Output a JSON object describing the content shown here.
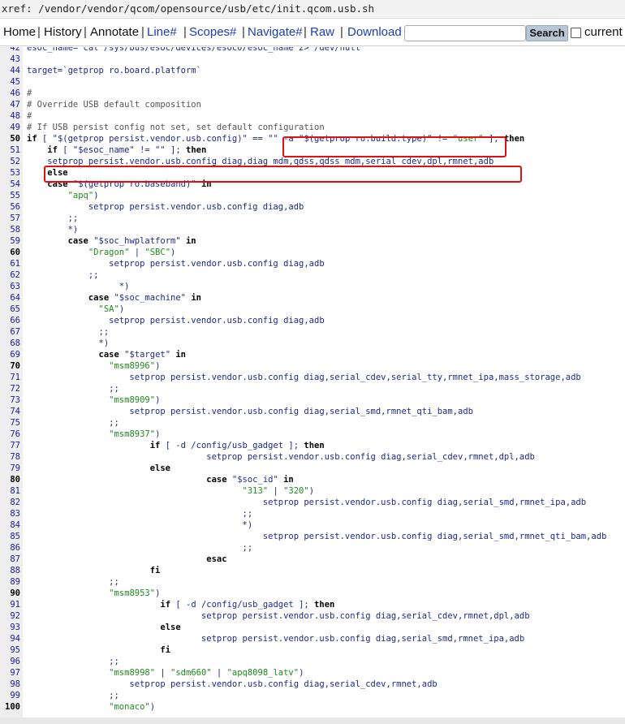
{
  "xref": {
    "prefix": "xref:",
    "path": " /vendor/vendor/qcom/opensource/usb/etc/init.qcom.usb.sh"
  },
  "nav": {
    "home": "Home",
    "history": "History",
    "annotate": "Annotate",
    "line": "Line#",
    "scopes": "Scopes#",
    "navigate": "Navigate#",
    "raw": "Raw",
    "download": "Download",
    "search_button": "Search",
    "current": "current",
    "search_value": ""
  },
  "highlight_color": "#e01010",
  "lines": [
    {
      "n": "42",
      "b": false,
      "parts": [
        {
          "t": "esoc_name=`cat /sys/bus/esoc/devices/esoc0/esoc_name 2> /dev/null`"
        }
      ]
    },
    {
      "n": "43",
      "b": false,
      "parts": [
        {
          "t": ""
        }
      ]
    },
    {
      "n": "44",
      "b": false,
      "parts": [
        {
          "t": "target=`getprop ro.board.platform`"
        }
      ]
    },
    {
      "n": "45",
      "b": false,
      "parts": [
        {
          "t": ""
        }
      ]
    },
    {
      "n": "46",
      "b": false,
      "parts": [
        {
          "t": "#",
          "c": "cm"
        }
      ]
    },
    {
      "n": "47",
      "b": false,
      "parts": [
        {
          "t": "# Override USB default composition",
          "c": "cm"
        }
      ]
    },
    {
      "n": "48",
      "b": false,
      "parts": [
        {
          "t": "#",
          "c": "cm"
        }
      ]
    },
    {
      "n": "49",
      "b": false,
      "parts": [
        {
          "t": "# If USB persist config not set, set default configuration",
          "c": "cm"
        }
      ]
    },
    {
      "n": "50",
      "b": true,
      "parts": [
        {
          "t": "if",
          "c": "kw"
        },
        {
          "t": " [ \"$(getprop persist.vendor.usb.config)\" == \"\" -a \"$(getprop ro.build.type)\" != "
        },
        {
          "t": "\"user\"",
          "c": "str"
        },
        {
          "t": " ]; "
        },
        {
          "t": "then",
          "c": "kw"
        }
      ]
    },
    {
      "n": "51",
      "b": false,
      "parts": [
        {
          "t": "    "
        },
        {
          "t": "if",
          "c": "kw"
        },
        {
          "t": " [ \"$esoc_name\" != \"\" ]; "
        },
        {
          "t": "then",
          "c": "kw"
        }
      ]
    },
    {
      "n": "52",
      "b": false,
      "parts": [
        {
          "t": "    setprop persist.vendor.usb.config diag,diag_mdm,qdss,qdss_mdm,serial_cdev,dpl,rmnet,adb"
        }
      ]
    },
    {
      "n": "53",
      "b": false,
      "parts": [
        {
          "t": "    "
        },
        {
          "t": "else",
          "c": "kw"
        }
      ]
    },
    {
      "n": "54",
      "b": false,
      "parts": [
        {
          "t": "    "
        },
        {
          "t": "case",
          "c": "kw"
        },
        {
          "t": " \"$(getprop ro.baseband)\" "
        },
        {
          "t": "in",
          "c": "kw"
        }
      ]
    },
    {
      "n": "55",
      "b": false,
      "parts": [
        {
          "t": "        "
        },
        {
          "t": "\"apq\"",
          "c": "str"
        },
        {
          "t": ")"
        }
      ]
    },
    {
      "n": "56",
      "b": false,
      "parts": [
        {
          "t": "            setprop persist.vendor.usb.config diag,adb"
        }
      ]
    },
    {
      "n": "57",
      "b": false,
      "parts": [
        {
          "t": "        ;;"
        }
      ]
    },
    {
      "n": "58",
      "b": false,
      "parts": [
        {
          "t": "        *)"
        }
      ]
    },
    {
      "n": "59",
      "b": false,
      "parts": [
        {
          "t": "        "
        },
        {
          "t": "case",
          "c": "kw"
        },
        {
          "t": " \"$soc_hwplatform\" "
        },
        {
          "t": "in",
          "c": "kw"
        }
      ]
    },
    {
      "n": "60",
      "b": true,
      "parts": [
        {
          "t": "            "
        },
        {
          "t": "\"Dragon\"",
          "c": "str"
        },
        {
          "t": " | "
        },
        {
          "t": "\"SBC\"",
          "c": "str"
        },
        {
          "t": ")"
        }
      ]
    },
    {
      "n": "61",
      "b": false,
      "parts": [
        {
          "t": "                setprop persist.vendor.usb.config diag,adb"
        }
      ]
    },
    {
      "n": "62",
      "b": false,
      "parts": [
        {
          "t": "            ;;"
        }
      ]
    },
    {
      "n": "63",
      "b": false,
      "parts": [
        {
          "t": "                  *)"
        }
      ]
    },
    {
      "n": "64",
      "b": false,
      "parts": [
        {
          "t": "            "
        },
        {
          "t": "case",
          "c": "kw"
        },
        {
          "t": " \"$soc_machine\" "
        },
        {
          "t": "in",
          "c": "kw"
        }
      ]
    },
    {
      "n": "65",
      "b": false,
      "parts": [
        {
          "t": "              "
        },
        {
          "t": "\"SA\"",
          "c": "str"
        },
        {
          "t": ")"
        }
      ]
    },
    {
      "n": "66",
      "b": false,
      "parts": [
        {
          "t": "                setprop persist.vendor.usb.config diag,adb"
        }
      ]
    },
    {
      "n": "67",
      "b": false,
      "parts": [
        {
          "t": "              ;;"
        }
      ]
    },
    {
      "n": "68",
      "b": false,
      "parts": [
        {
          "t": "              *)"
        }
      ]
    },
    {
      "n": "69",
      "b": false,
      "parts": [
        {
          "t": "              "
        },
        {
          "t": "case",
          "c": "kw"
        },
        {
          "t": " \"$target\" "
        },
        {
          "t": "in",
          "c": "kw"
        }
      ]
    },
    {
      "n": "70",
      "b": true,
      "parts": [
        {
          "t": "                "
        },
        {
          "t": "\"msm8996\"",
          "c": "str"
        },
        {
          "t": ")"
        }
      ]
    },
    {
      "n": "71",
      "b": false,
      "parts": [
        {
          "t": "                    setprop persist.vendor.usb.config diag,serial_cdev,serial_tty,rmnet_ipa,mass_storage,adb"
        }
      ]
    },
    {
      "n": "72",
      "b": false,
      "parts": [
        {
          "t": "                ;;"
        }
      ]
    },
    {
      "n": "73",
      "b": false,
      "parts": [
        {
          "t": "                "
        },
        {
          "t": "\"msm8909\"",
          "c": "str"
        },
        {
          "t": ")"
        }
      ]
    },
    {
      "n": "74",
      "b": false,
      "parts": [
        {
          "t": "                    setprop persist.vendor.usb.config diag,serial_smd,rmnet_qti_bam,adb"
        }
      ]
    },
    {
      "n": "75",
      "b": false,
      "parts": [
        {
          "t": "                ;;"
        }
      ]
    },
    {
      "n": "76",
      "b": false,
      "parts": [
        {
          "t": "                "
        },
        {
          "t": "\"msm8937\"",
          "c": "str"
        },
        {
          "t": ")"
        }
      ]
    },
    {
      "n": "77",
      "b": false,
      "parts": [
        {
          "t": "                        "
        },
        {
          "t": "if",
          "c": "kw"
        },
        {
          "t": " [ -d /config/usb_gadget ]; "
        },
        {
          "t": "then",
          "c": "kw"
        }
      ]
    },
    {
      "n": "78",
      "b": false,
      "parts": [
        {
          "t": "                                   setprop persist.vendor.usb.config diag,serial_cdev,rmnet,dpl,adb"
        }
      ]
    },
    {
      "n": "79",
      "b": false,
      "parts": [
        {
          "t": "                        "
        },
        {
          "t": "else",
          "c": "kw"
        }
      ]
    },
    {
      "n": "80",
      "b": true,
      "parts": [
        {
          "t": "                                   "
        },
        {
          "t": "case",
          "c": "kw"
        },
        {
          "t": " \"$soc_id\" "
        },
        {
          "t": "in",
          "c": "kw"
        }
      ]
    },
    {
      "n": "81",
      "b": false,
      "parts": [
        {
          "t": "                                          "
        },
        {
          "t": "\"313\"",
          "c": "str"
        },
        {
          "t": " | "
        },
        {
          "t": "\"320\"",
          "c": "str"
        },
        {
          "t": ")"
        }
      ]
    },
    {
      "n": "82",
      "b": false,
      "parts": [
        {
          "t": "                                              setprop persist.vendor.usb.config diag,serial_smd,rmnet_ipa,adb"
        }
      ]
    },
    {
      "n": "83",
      "b": false,
      "parts": [
        {
          "t": "                                          ;;"
        }
      ]
    },
    {
      "n": "84",
      "b": false,
      "parts": [
        {
          "t": "                                          *)"
        }
      ]
    },
    {
      "n": "85",
      "b": false,
      "parts": [
        {
          "t": "                                              setprop persist.vendor.usb.config diag,serial_smd,rmnet_qti_bam,adb"
        }
      ]
    },
    {
      "n": "86",
      "b": false,
      "parts": [
        {
          "t": "                                          ;;"
        }
      ]
    },
    {
      "n": "87",
      "b": false,
      "parts": [
        {
          "t": "                                   "
        },
        {
          "t": "esac",
          "c": "kw"
        }
      ]
    },
    {
      "n": "88",
      "b": false,
      "parts": [
        {
          "t": "                        "
        },
        {
          "t": "fi",
          "c": "kw"
        }
      ]
    },
    {
      "n": "89",
      "b": false,
      "parts": [
        {
          "t": "                ;;"
        }
      ]
    },
    {
      "n": "90",
      "b": true,
      "parts": [
        {
          "t": "                "
        },
        {
          "t": "\"msm8953\"",
          "c": "str"
        },
        {
          "t": ")"
        }
      ]
    },
    {
      "n": "91",
      "b": false,
      "parts": [
        {
          "t": "                          "
        },
        {
          "t": "if",
          "c": "kw"
        },
        {
          "t": " [ -d /config/usb_gadget ]; "
        },
        {
          "t": "then",
          "c": "kw"
        }
      ]
    },
    {
      "n": "92",
      "b": false,
      "parts": [
        {
          "t": "                                  setprop persist.vendor.usb.config diag,serial_cdev,rmnet,dpl,adb"
        }
      ]
    },
    {
      "n": "93",
      "b": false,
      "parts": [
        {
          "t": "                          "
        },
        {
          "t": "else",
          "c": "kw"
        }
      ]
    },
    {
      "n": "94",
      "b": false,
      "parts": [
        {
          "t": "                                  setprop persist.vendor.usb.config diag,serial_smd,rmnet_ipa,adb"
        }
      ]
    },
    {
      "n": "95",
      "b": false,
      "parts": [
        {
          "t": "                          "
        },
        {
          "t": "fi",
          "c": "kw"
        }
      ]
    },
    {
      "n": "96",
      "b": false,
      "parts": [
        {
          "t": "                ;;"
        }
      ]
    },
    {
      "n": "97",
      "b": false,
      "parts": [
        {
          "t": "                "
        },
        {
          "t": "\"msm8998\"",
          "c": "str"
        },
        {
          "t": " | "
        },
        {
          "t": "\"sdm660\"",
          "c": "str"
        },
        {
          "t": " | "
        },
        {
          "t": "\"apq8098_latv\"",
          "c": "str"
        },
        {
          "t": ")"
        }
      ]
    },
    {
      "n": "98",
      "b": false,
      "parts": [
        {
          "t": "                    setprop persist.vendor.usb.config diag,serial_cdev,rmnet,adb"
        }
      ]
    },
    {
      "n": "99",
      "b": false,
      "parts": [
        {
          "t": "                ;;"
        }
      ]
    },
    {
      "n": "100",
      "b": true,
      "parts": [
        {
          "t": "                "
        },
        {
          "t": "\"monaco\"",
          "c": "str"
        },
        {
          "t": ")"
        }
      ]
    }
  ]
}
